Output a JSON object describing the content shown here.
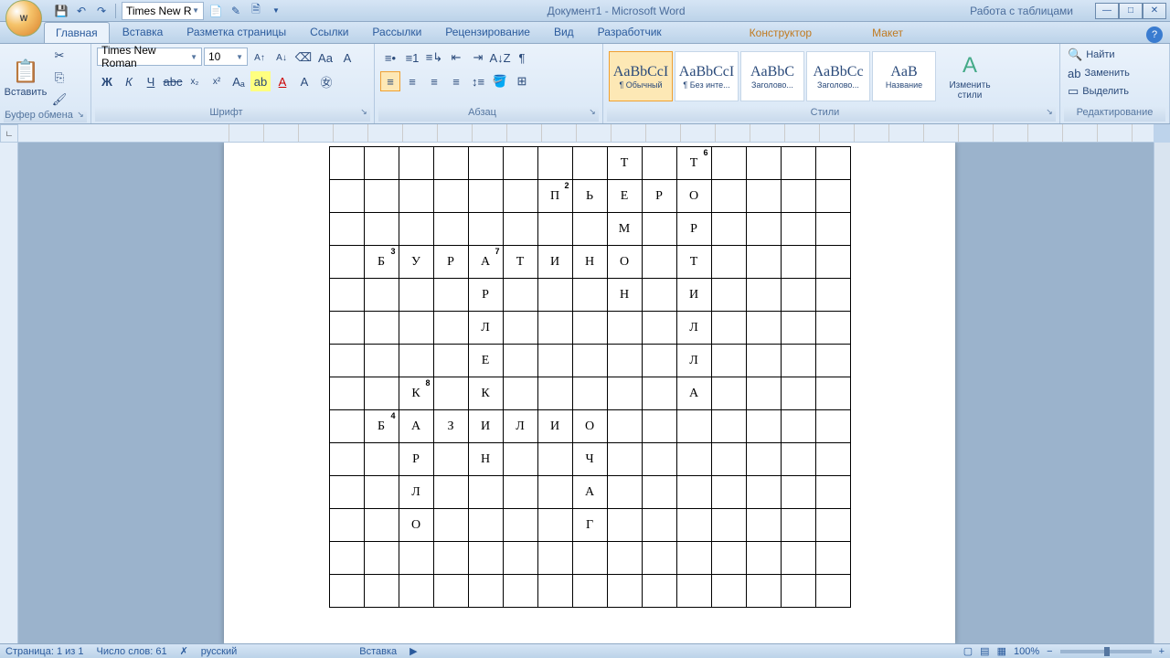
{
  "app": {
    "title": "Документ1 - Microsoft Word",
    "context_title": "Работа с таблицами"
  },
  "qat": {
    "font_input": "Times New R"
  },
  "tabs": [
    "Главная",
    "Вставка",
    "Разметка страницы",
    "Ссылки",
    "Рассылки",
    "Рецензирование",
    "Вид",
    "Разработчик"
  ],
  "context_tabs": [
    "Конструктор",
    "Макет"
  ],
  "active_tab": 0,
  "ribbon": {
    "clipboard": {
      "paste": "Вставить",
      "label": "Буфер обмена"
    },
    "font": {
      "name": "Times New Roman",
      "size": "10",
      "label": "Шрифт"
    },
    "paragraph": {
      "label": "Абзац"
    },
    "styles": {
      "label": "Стили",
      "items": [
        {
          "preview": "AaBbCcI",
          "name": "¶ Обычный"
        },
        {
          "preview": "AaBbCcI",
          "name": "¶ Без инте..."
        },
        {
          "preview": "AaBbC",
          "name": "Заголово..."
        },
        {
          "preview": "AaBbCc",
          "name": "Заголово..."
        },
        {
          "preview": "AaB",
          "name": "Название"
        }
      ],
      "change": "Изменить стили"
    },
    "editing": {
      "find": "Найти",
      "replace": "Заменить",
      "select": "Выделить",
      "label": "Редактирование"
    }
  },
  "crossword": {
    "cols": 15,
    "rows": 14,
    "cells": [
      {
        "r": 0,
        "c": 8,
        "l": "Т"
      },
      {
        "r": 0,
        "c": 10,
        "l": "Т",
        "n": "6"
      },
      {
        "r": 1,
        "c": 6,
        "l": "П",
        "n": "2"
      },
      {
        "r": 1,
        "c": 7,
        "l": "Ь"
      },
      {
        "r": 1,
        "c": 8,
        "l": "Е"
      },
      {
        "r": 1,
        "c": 9,
        "l": "Р"
      },
      {
        "r": 1,
        "c": 10,
        "l": "О"
      },
      {
        "r": 2,
        "c": 8,
        "l": "М"
      },
      {
        "r": 2,
        "c": 10,
        "l": "Р"
      },
      {
        "r": 3,
        "c": 1,
        "l": "Б",
        "n": "3"
      },
      {
        "r": 3,
        "c": 2,
        "l": "У"
      },
      {
        "r": 3,
        "c": 3,
        "l": "Р"
      },
      {
        "r": 3,
        "c": 4,
        "l": "А",
        "n": "7"
      },
      {
        "r": 3,
        "c": 5,
        "l": "Т"
      },
      {
        "r": 3,
        "c": 6,
        "l": "И"
      },
      {
        "r": 3,
        "c": 7,
        "l": "Н"
      },
      {
        "r": 3,
        "c": 8,
        "l": "О"
      },
      {
        "r": 3,
        "c": 10,
        "l": "Т"
      },
      {
        "r": 4,
        "c": 4,
        "l": "Р"
      },
      {
        "r": 4,
        "c": 8,
        "l": "Н"
      },
      {
        "r": 4,
        "c": 10,
        "l": "И"
      },
      {
        "r": 5,
        "c": 4,
        "l": "Л"
      },
      {
        "r": 5,
        "c": 10,
        "l": "Л"
      },
      {
        "r": 6,
        "c": 4,
        "l": "Е"
      },
      {
        "r": 6,
        "c": 10,
        "l": "Л"
      },
      {
        "r": 7,
        "c": 2,
        "l": "К",
        "n": "8"
      },
      {
        "r": 7,
        "c": 4,
        "l": "К"
      },
      {
        "r": 7,
        "c": 10,
        "l": "А"
      },
      {
        "r": 8,
        "c": 1,
        "l": "Б",
        "n": "4"
      },
      {
        "r": 8,
        "c": 2,
        "l": "А"
      },
      {
        "r": 8,
        "c": 3,
        "l": "З"
      },
      {
        "r": 8,
        "c": 4,
        "l": "И"
      },
      {
        "r": 8,
        "c": 5,
        "l": "Л"
      },
      {
        "r": 8,
        "c": 6,
        "l": "И"
      },
      {
        "r": 8,
        "c": 7,
        "l": "О"
      },
      {
        "r": 9,
        "c": 2,
        "l": "Р"
      },
      {
        "r": 9,
        "c": 4,
        "l": "Н"
      },
      {
        "r": 9,
        "c": 7,
        "l": "Ч"
      },
      {
        "r": 10,
        "c": 2,
        "l": "Л"
      },
      {
        "r": 10,
        "c": 7,
        "l": "А"
      },
      {
        "r": 11,
        "c": 2,
        "l": "О"
      },
      {
        "r": 11,
        "c": 7,
        "l": "Г"
      }
    ]
  },
  "status": {
    "page": "Страница: 1 из 1",
    "words": "Число слов: 61",
    "lang": "русский",
    "mode": "Вставка",
    "zoom": "100%"
  }
}
